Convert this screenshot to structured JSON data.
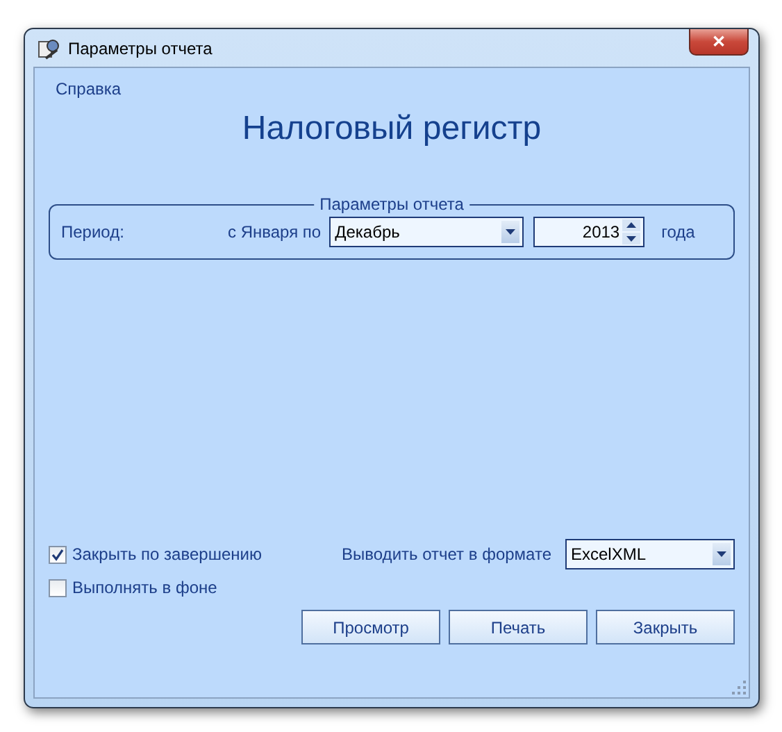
{
  "window": {
    "title": "Параметры отчета",
    "close": "✕"
  },
  "menu": [
    {
      "label": "Справка"
    }
  ],
  "heading": "Налоговый регистр",
  "group": {
    "title": "Параметры отчета",
    "period_label": "Период:",
    "from_label": "с Января по",
    "month": "Декабрь",
    "year": "2013",
    "year_suffix": "года"
  },
  "options": [
    {
      "label": "Закрыть по завершению",
      "checked": true
    },
    {
      "label": "Выполнять в фоне",
      "checked": false
    }
  ],
  "format": {
    "label": "Выводить отчет в формате",
    "value": "ExcelXML"
  },
  "buttons": [
    "Просмотр",
    "Печать",
    "Закрыть"
  ]
}
